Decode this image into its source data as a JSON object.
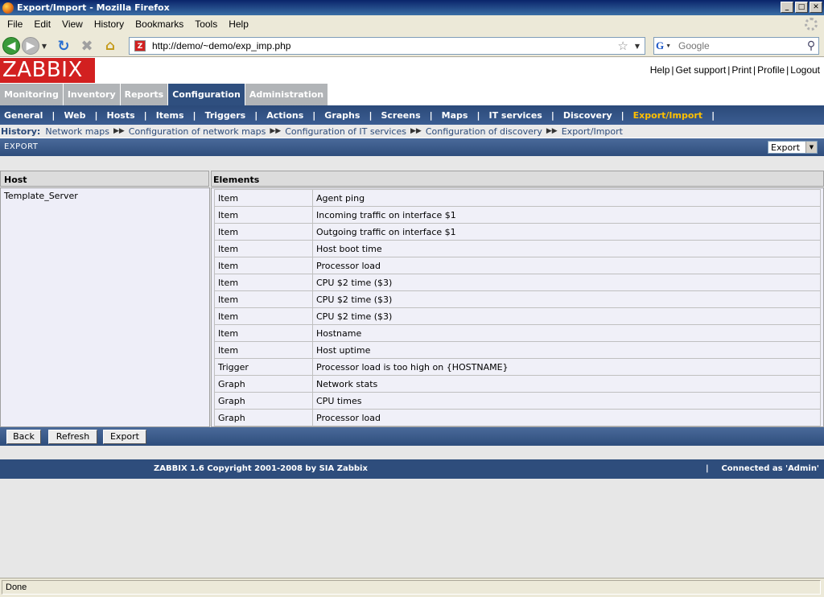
{
  "window": {
    "title": "Export/Import - Mozilla Firefox",
    "controls": {
      "minimize": "_",
      "maximize": "□",
      "close": "✕"
    }
  },
  "menubar": [
    "File",
    "Edit",
    "View",
    "History",
    "Bookmarks",
    "Tools",
    "Help"
  ],
  "navbar": {
    "url": "http://demo/~demo/exp_imp.php",
    "search_placeholder": "Google",
    "search_engine": "G"
  },
  "zabbix": {
    "logo": "ZABBIX",
    "top_links": [
      "Help",
      "Get support",
      "Print",
      "Profile",
      "Logout"
    ],
    "main_tabs": [
      {
        "label": "Monitoring",
        "active": false
      },
      {
        "label": "Inventory",
        "active": false
      },
      {
        "label": "Reports",
        "active": false
      },
      {
        "label": "Configuration",
        "active": true
      },
      {
        "label": "Administration",
        "active": false
      }
    ],
    "submenu": [
      {
        "label": "General",
        "active": false
      },
      {
        "label": "Web",
        "active": false
      },
      {
        "label": "Hosts",
        "active": false
      },
      {
        "label": "Items",
        "active": false
      },
      {
        "label": "Triggers",
        "active": false
      },
      {
        "label": "Actions",
        "active": false
      },
      {
        "label": "Graphs",
        "active": false
      },
      {
        "label": "Screens",
        "active": false
      },
      {
        "label": "Maps",
        "active": false
      },
      {
        "label": "IT services",
        "active": false
      },
      {
        "label": "Discovery",
        "active": false
      },
      {
        "label": "Export/Import",
        "active": true
      }
    ],
    "history": {
      "label": "History:",
      "items": [
        "Network maps",
        "Configuration of network maps",
        "Configuration of IT services",
        "Configuration of discovery",
        "Export/Import"
      ]
    },
    "page": {
      "title": "EXPORT",
      "select_value": "Export"
    },
    "table": {
      "headers": {
        "host": "Host",
        "elements": "Elements"
      },
      "host": "Template_Server",
      "elements": [
        {
          "type": "Item",
          "name": "Agent ping"
        },
        {
          "type": "Item",
          "name": "Incoming traffic on interface $1"
        },
        {
          "type": "Item",
          "name": "Outgoing traffic on interface $1"
        },
        {
          "type": "Item",
          "name": "Host boot time"
        },
        {
          "type": "Item",
          "name": "Processor load"
        },
        {
          "type": "Item",
          "name": "CPU $2 time ($3)"
        },
        {
          "type": "Item",
          "name": "CPU $2 time ($3)"
        },
        {
          "type": "Item",
          "name": "CPU $2 time ($3)"
        },
        {
          "type": "Item",
          "name": "Hostname"
        },
        {
          "type": "Item",
          "name": "Host uptime"
        },
        {
          "type": "Trigger",
          "name": "Processor load is too high on {HOSTNAME}"
        },
        {
          "type": "Graph",
          "name": "Network stats"
        },
        {
          "type": "Graph",
          "name": "CPU times"
        },
        {
          "type": "Graph",
          "name": "Processor load"
        }
      ]
    },
    "buttons": {
      "back": "Back",
      "refresh": "Refresh",
      "export": "Export"
    },
    "footer": {
      "copyright": "ZABBIX 1.6 Copyright 2001-2008 by  SIA Zabbix",
      "separator": "|",
      "connected": "Connected as 'Admin'"
    }
  },
  "statusbar": {
    "text": "Done"
  },
  "colors": {
    "brand_red": "#d22020",
    "nav_blue": "#2e4d7c",
    "active_yellow": "#ffc000",
    "tab_gray": "#b1b4b7"
  }
}
